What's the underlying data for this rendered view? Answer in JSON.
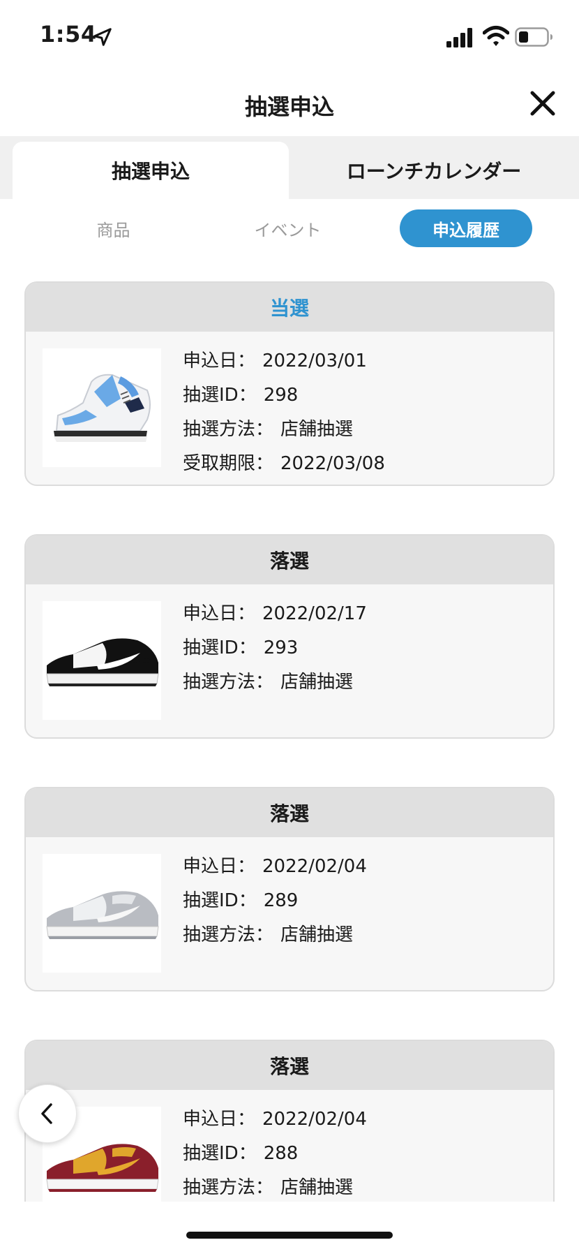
{
  "status_bar": {
    "time": "1:54"
  },
  "header": {
    "title": "抽選申込"
  },
  "main_tabs": [
    {
      "label": "抽選申込",
      "active": true
    },
    {
      "label": "ローンチカレンダー",
      "active": false
    }
  ],
  "sub_tabs": [
    {
      "label": "商品",
      "active": false
    },
    {
      "label": "イベント",
      "active": false
    },
    {
      "label": "申込履歴",
      "active": true
    }
  ],
  "labels": {
    "apply_date": "申込日：",
    "lottery_id": "抽選ID：",
    "method": "抽選方法：",
    "pickup_deadline": "受取期限："
  },
  "entries": [
    {
      "result": "当選",
      "apply_date": "2022/03/01",
      "lottery_id": "298",
      "method": "店舗抽選",
      "pickup_deadline": "2022/03/08",
      "shoe": "blue-white-jordan"
    },
    {
      "result": "落選",
      "apply_date": "2022/02/17",
      "lottery_id": "293",
      "method": "店舗抽選",
      "shoe": "black-white-dunk"
    },
    {
      "result": "落選",
      "apply_date": "2022/02/04",
      "lottery_id": "289",
      "method": "店舗抽選",
      "shoe": "grey-dunk"
    },
    {
      "result": "落選",
      "apply_date": "2022/02/04",
      "lottery_id": "288",
      "method": "店舗抽選",
      "shoe": "maroon-gold-dunk"
    }
  ],
  "colors": {
    "accent": "#2f93d0",
    "card_header": "#e0e0e0",
    "card_body": "#f7f7f7"
  }
}
